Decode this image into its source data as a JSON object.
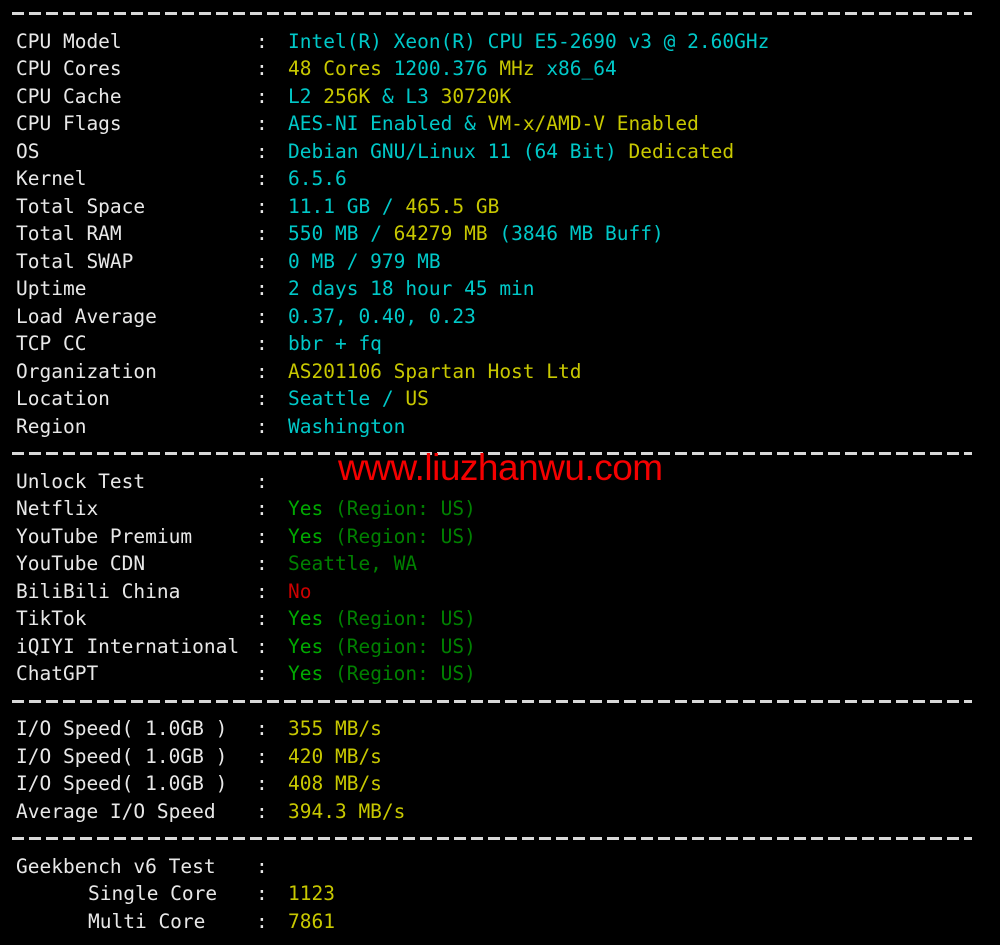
{
  "terminal": {
    "background_color": "#000000",
    "watermark": "www.liuzhanwu.com",
    "watermark_color": "#f50000",
    "colors": {
      "label": "#e8e8e8",
      "cyan": "#00c8c8",
      "yellow": "#c8c800",
      "green": "#00aa00",
      "dark_green": "#008000",
      "red": "#cc0000"
    },
    "separator": "------------------------------------------------------------------"
  },
  "sections": [
    {
      "name": "system-info",
      "rows": [
        {
          "label": "CPU Model",
          "segments": [
            {
              "text": "Intel(R) Xeon(R) CPU E5-2690 v3 @ 2.60GHz",
              "color": "cyan"
            }
          ]
        },
        {
          "label": "CPU Cores",
          "segments": [
            {
              "text": "48 Cores ",
              "color": "yellow"
            },
            {
              "text": "1200.376 ",
              "color": "cyan"
            },
            {
              "text": "MHz ",
              "color": "yellow"
            },
            {
              "text": "x86_64",
              "color": "cyan"
            }
          ]
        },
        {
          "label": "CPU Cache",
          "segments": [
            {
              "text": "L2 ",
              "color": "cyan"
            },
            {
              "text": "256K ",
              "color": "yellow"
            },
            {
              "text": "& ",
              "color": "cyan"
            },
            {
              "text": "L3 ",
              "color": "cyan"
            },
            {
              "text": "30720K",
              "color": "yellow"
            }
          ]
        },
        {
          "label": "CPU Flags",
          "segments": [
            {
              "text": "AES-NI Enabled ",
              "color": "cyan"
            },
            {
              "text": "& ",
              "color": "cyan"
            },
            {
              "text": "VM-x/AMD-V Enabled",
              "color": "yellow"
            }
          ]
        },
        {
          "label": "OS",
          "segments": [
            {
              "text": "Debian GNU/Linux 11 (64 Bit) ",
              "color": "cyan"
            },
            {
              "text": "Dedicated",
              "color": "yellow"
            }
          ]
        },
        {
          "label": "Kernel",
          "segments": [
            {
              "text": "6.5.6",
              "color": "cyan"
            }
          ]
        },
        {
          "label": "Total Space",
          "segments": [
            {
              "text": "11.1 GB ",
              "color": "cyan"
            },
            {
              "text": "/ ",
              "color": "cyan"
            },
            {
              "text": "465.5 GB",
              "color": "yellow"
            }
          ]
        },
        {
          "label": "Total RAM",
          "segments": [
            {
              "text": "550 MB ",
              "color": "cyan"
            },
            {
              "text": "/ ",
              "color": "cyan"
            },
            {
              "text": "64279 MB ",
              "color": "yellow"
            },
            {
              "text": "(3846 MB Buff)",
              "color": "cyan"
            }
          ]
        },
        {
          "label": "Total SWAP",
          "segments": [
            {
              "text": "0 MB / 979 MB",
              "color": "cyan"
            }
          ]
        },
        {
          "label": "Uptime",
          "segments": [
            {
              "text": "2 days 18 hour 45 min",
              "color": "cyan"
            }
          ]
        },
        {
          "label": "Load Average",
          "segments": [
            {
              "text": "0.37, 0.40, 0.23",
              "color": "cyan"
            }
          ]
        },
        {
          "label": "TCP CC",
          "segments": [
            {
              "text": "bbr + fq",
              "color": "cyan"
            }
          ]
        },
        {
          "label": "Organization",
          "segments": [
            {
              "text": "AS201106 Spartan Host Ltd",
              "color": "yellow"
            }
          ]
        },
        {
          "label": "Location",
          "segments": [
            {
              "text": "Seattle / ",
              "color": "cyan"
            },
            {
              "text": "US",
              "color": "yellow"
            }
          ]
        },
        {
          "label": "Region",
          "segments": [
            {
              "text": "Washington",
              "color": "cyan"
            }
          ]
        }
      ]
    },
    {
      "name": "unlock-test",
      "rows": [
        {
          "label": "Unlock Test",
          "segments": []
        },
        {
          "label": "Netflix",
          "segments": [
            {
              "text": "Yes ",
              "color": "green"
            },
            {
              "text": "(Region: US)",
              "color": "dark_green"
            }
          ]
        },
        {
          "label": "YouTube Premium",
          "segments": [
            {
              "text": "Yes ",
              "color": "green"
            },
            {
              "text": "(Region: US)",
              "color": "dark_green"
            }
          ]
        },
        {
          "label": "YouTube CDN",
          "segments": [
            {
              "text": "Seattle, WA",
              "color": "dark_green"
            }
          ]
        },
        {
          "label": "BiliBili China",
          "segments": [
            {
              "text": "No",
              "color": "red"
            }
          ]
        },
        {
          "label": "TikTok",
          "segments": [
            {
              "text": "Yes ",
              "color": "green"
            },
            {
              "text": "(Region: US)",
              "color": "dark_green"
            }
          ]
        },
        {
          "label": "iQIYI International",
          "segments": [
            {
              "text": "Yes ",
              "color": "green"
            },
            {
              "text": "(Region: US)",
              "color": "dark_green"
            }
          ]
        },
        {
          "label": "ChatGPT",
          "segments": [
            {
              "text": "Yes ",
              "color": "green"
            },
            {
              "text": "(Region: US)",
              "color": "dark_green"
            }
          ]
        }
      ]
    },
    {
      "name": "io-speed",
      "rows": [
        {
          "label": "I/O Speed( 1.0GB )",
          "segments": [
            {
              "text": "355 MB/s",
              "color": "yellow"
            }
          ]
        },
        {
          "label": "I/O Speed( 1.0GB )",
          "segments": [
            {
              "text": "420 MB/s",
              "color": "yellow"
            }
          ]
        },
        {
          "label": "I/O Speed( 1.0GB )",
          "segments": [
            {
              "text": "408 MB/s",
              "color": "yellow"
            }
          ]
        },
        {
          "label": "Average I/O Speed",
          "segments": [
            {
              "text": "394.3 MB/s",
              "color": "yellow"
            }
          ]
        }
      ]
    },
    {
      "name": "geekbench",
      "rows": [
        {
          "label": "Geekbench v6 Test",
          "segments": []
        },
        {
          "label": "Single Core",
          "indent": true,
          "segments": [
            {
              "text": "1123",
              "color": "yellow"
            }
          ]
        },
        {
          "label": "Multi Core",
          "indent": true,
          "segments": [
            {
              "text": "7861",
              "color": "yellow"
            }
          ]
        }
      ]
    }
  ]
}
